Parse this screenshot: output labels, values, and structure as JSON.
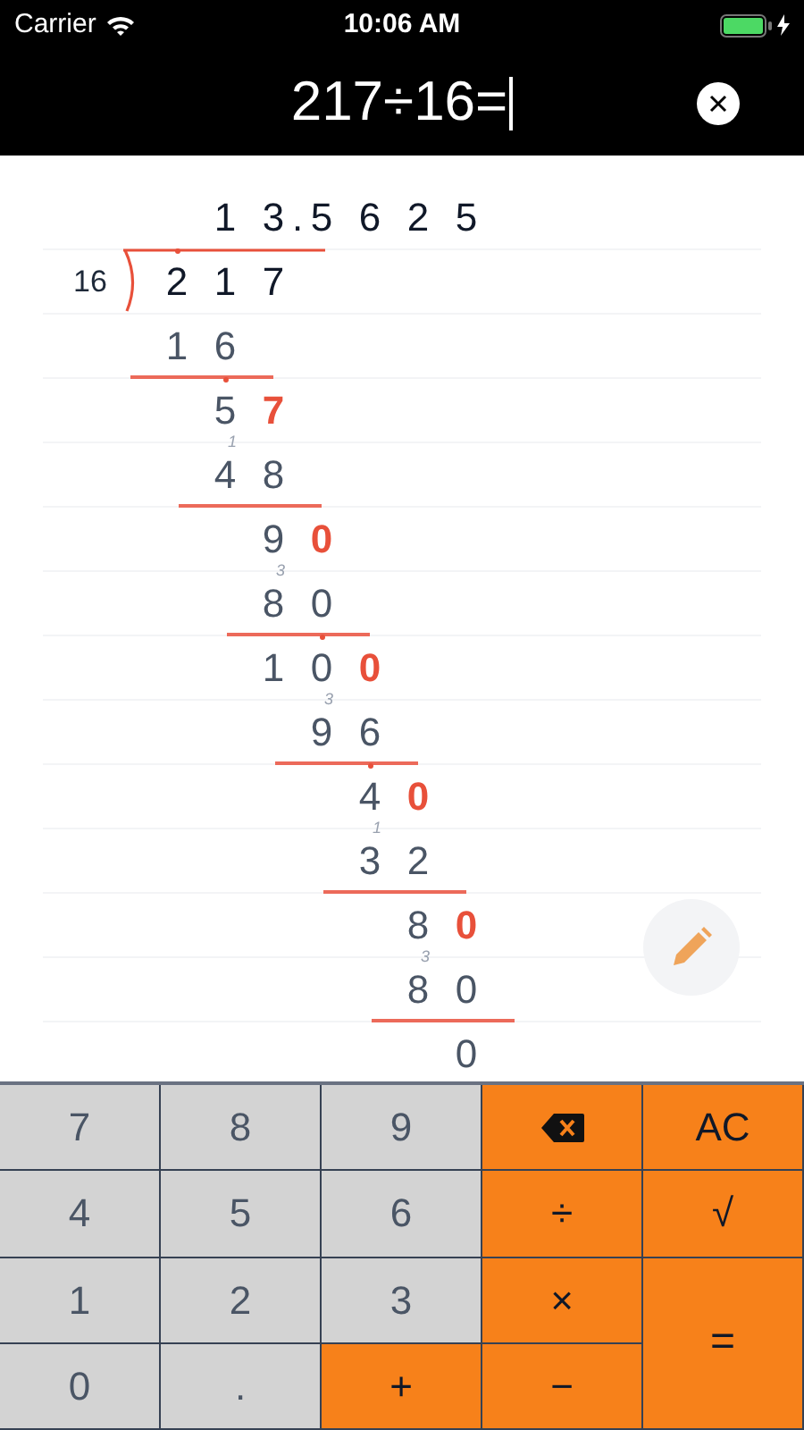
{
  "status_bar": {
    "carrier": "Carrier",
    "time": "10:06 AM"
  },
  "expression": {
    "value": "217÷16="
  },
  "division": {
    "divisor": "16",
    "quotient": [
      "1",
      "3",
      ".",
      "5",
      "6",
      "2",
      "5"
    ],
    "rows": [
      {
        "underline": false,
        "digits": [
          {
            "text": "2",
            "dot": true
          },
          {
            "text": "1"
          },
          {
            "text": "7"
          }
        ]
      },
      {
        "underline": true,
        "digits": [
          {
            "text": "1"
          },
          {
            "text": "6"
          }
        ]
      },
      {
        "underline": false,
        "digits": [
          {
            "text": "5",
            "dot": true
          },
          {
            "text": "7",
            "highlight": true
          }
        ]
      },
      {
        "underline": true,
        "digits": [
          {
            "text": "4",
            "carry": "1"
          },
          {
            "text": "8"
          }
        ]
      },
      {
        "underline": false,
        "digits": [
          {
            "text": "9"
          },
          {
            "text": "0",
            "highlight": true
          }
        ]
      },
      {
        "underline": true,
        "digits": [
          {
            "text": "8",
            "carry": "3"
          },
          {
            "text": "0"
          }
        ]
      },
      {
        "underline": false,
        "digits": [
          {
            "text": "1"
          },
          {
            "text": "0",
            "dot": true
          },
          {
            "text": "0",
            "highlight": true
          }
        ]
      },
      {
        "underline": true,
        "digits": [
          {
            "text": "9",
            "carry": "3"
          },
          {
            "text": "6"
          }
        ]
      },
      {
        "underline": false,
        "digits": [
          {
            "text": "4",
            "dot": true
          },
          {
            "text": "0",
            "highlight": true
          }
        ]
      },
      {
        "underline": true,
        "digits": [
          {
            "text": "3",
            "carry": "1"
          },
          {
            "text": "2"
          }
        ]
      },
      {
        "underline": false,
        "digits": [
          {
            "text": "8"
          },
          {
            "text": "0",
            "highlight": true
          }
        ]
      },
      {
        "underline": true,
        "digits": [
          {
            "text": "8",
            "carry": "3"
          },
          {
            "text": "0"
          }
        ]
      },
      {
        "underline": false,
        "digits": [
          {
            "text": "0"
          }
        ]
      }
    ]
  },
  "keypad": [
    {
      "label": "7",
      "kind": "digit"
    },
    {
      "label": "8",
      "kind": "digit"
    },
    {
      "label": "9",
      "kind": "digit"
    },
    {
      "kind": "backspace"
    },
    {
      "label": "AC",
      "kind": "operator"
    },
    {
      "label": "4",
      "kind": "digit"
    },
    {
      "label": "5",
      "kind": "digit"
    },
    {
      "label": "6",
      "kind": "digit"
    },
    {
      "label": "÷",
      "kind": "operator"
    },
    {
      "label": "√",
      "kind": "operator"
    },
    {
      "label": "1",
      "kind": "digit"
    },
    {
      "label": "2",
      "kind": "digit"
    },
    {
      "label": "3",
      "kind": "digit"
    },
    {
      "label": "×",
      "kind": "operator"
    },
    {
      "label": "=",
      "kind": "equals"
    },
    {
      "label": "0",
      "kind": "digit"
    },
    {
      "label": ".",
      "kind": "digit"
    },
    {
      "label": "+",
      "kind": "operator"
    },
    {
      "label": "−",
      "kind": "operator"
    }
  ]
}
